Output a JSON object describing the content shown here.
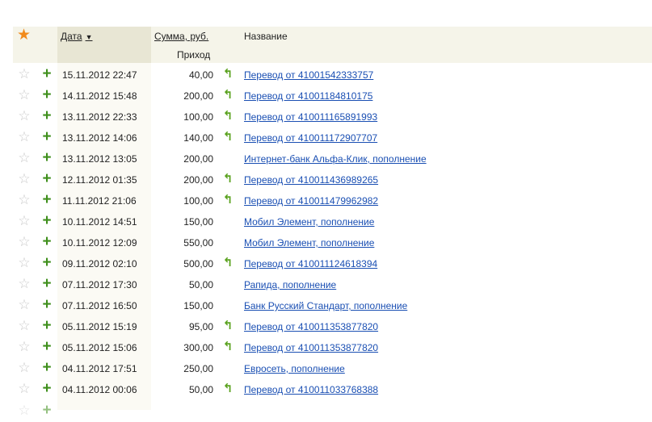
{
  "header": {
    "date_label": "Дата",
    "sum_label": "Сумма, руб.",
    "income_label": "Приход",
    "name_label": "Название"
  },
  "rows": [
    {
      "date": "15.11.2012 22:47",
      "amount": "40,00",
      "return_icon": true,
      "name": "Перевод от 41001542333757"
    },
    {
      "date": "14.11.2012 15:48",
      "amount": "200,00",
      "return_icon": true,
      "name": "Перевод от 41001184810175"
    },
    {
      "date": "13.11.2012 22:33",
      "amount": "100,00",
      "return_icon": true,
      "name": "Перевод от 410011165891993"
    },
    {
      "date": "13.11.2012 14:06",
      "amount": "140,00",
      "return_icon": true,
      "name": "Перевод от 410011172907707"
    },
    {
      "date": "13.11.2012 13:05",
      "amount": "200,00",
      "return_icon": false,
      "name": "Интернет-банк Альфа-Клик, пополнение"
    },
    {
      "date": "12.11.2012 01:35",
      "amount": "200,00",
      "return_icon": true,
      "name": "Перевод от 410011436989265"
    },
    {
      "date": "11.11.2012 21:06",
      "amount": "100,00",
      "return_icon": true,
      "name": "Перевод от 410011479962982"
    },
    {
      "date": "10.11.2012 14:51",
      "amount": "150,00",
      "return_icon": false,
      "name": "Мобил Элемент, пополнение"
    },
    {
      "date": "10.11.2012 12:09",
      "amount": "550,00",
      "return_icon": false,
      "name": "Мобил Элемент, пополнение"
    },
    {
      "date": "09.11.2012 02:10",
      "amount": "500,00",
      "return_icon": true,
      "name": "Перевод от 410011124618394"
    },
    {
      "date": "07.11.2012 17:30",
      "amount": "50,00",
      "return_icon": false,
      "name": "Рапида, пополнение"
    },
    {
      "date": "07.11.2012 16:50",
      "amount": "150,00",
      "return_icon": false,
      "name": "Банк Русский Стандарт, пополнение"
    },
    {
      "date": "05.11.2012 15:19",
      "amount": "95,00",
      "return_icon": true,
      "name": "Перевод от 410011353877820"
    },
    {
      "date": "05.11.2012 15:06",
      "amount": "300,00",
      "return_icon": true,
      "name": "Перевод от 410011353877820"
    },
    {
      "date": "04.11.2012 17:51",
      "amount": "250,00",
      "return_icon": false,
      "name": "Евросеть, пополнение"
    },
    {
      "date": "04.11.2012 00:06",
      "amount": "50,00",
      "return_icon": true,
      "name": "Перевод от 410011033768388"
    }
  ],
  "icons": {
    "star_empty": "☆",
    "star_filled": "★",
    "plus": "+",
    "return": "↰"
  },
  "colors": {
    "header_bg": "#f5f4e9",
    "sorted_col": "#e8e6d4",
    "link": "#1a4fb3",
    "plus": "#3f8f1c",
    "star_active": "#f18a1c"
  }
}
